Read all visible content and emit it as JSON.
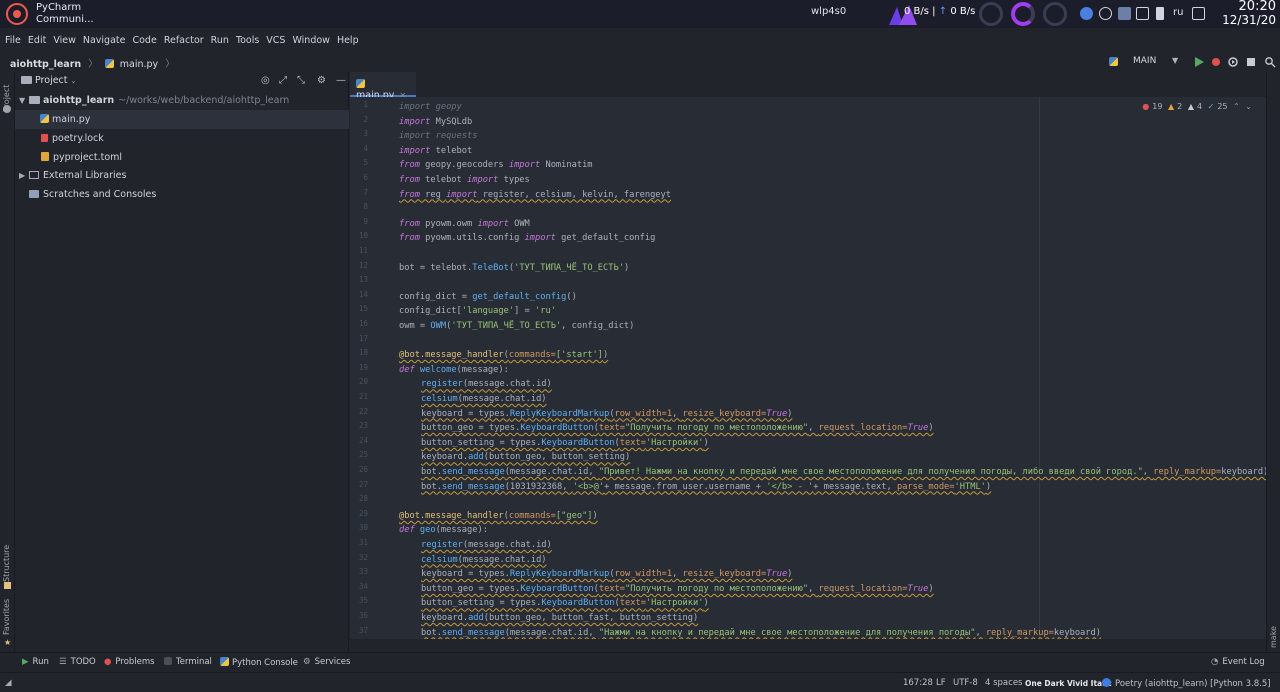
{
  "system_bar": {
    "app_name": "PyCharm",
    "app_sub": "Communi...",
    "network_name": "wlp4s0",
    "download": "0 B/s",
    "separator": "|",
    "upload_arrow": "↑",
    "upload": "0 B/s",
    "keyboard_layout": "ru",
    "time": "20:20",
    "date": "12/31/20"
  },
  "menu": [
    "File",
    "Edit",
    "View",
    "Navigate",
    "Code",
    "Refactor",
    "Run",
    "Tools",
    "VCS",
    "Window",
    "Help"
  ],
  "nav": {
    "project": "aiohttp_learn",
    "file": "main.py",
    "run_config": "MAIN"
  },
  "left_strip": {
    "project": "Project",
    "structure": "Structure",
    "favorites": "Favorites"
  },
  "right_strip": {
    "make": "make"
  },
  "project_panel": {
    "title": "Project",
    "root": {
      "name": "aiohttp_learn",
      "path": "~/works/web/backend/aiohttp_learn"
    },
    "files": [
      "main.py",
      "poetry.lock",
      "pyproject.toml"
    ],
    "external_libraries": "External Libraries",
    "scratches": "Scratches and Consoles"
  },
  "editor": {
    "tab": "main.py",
    "inspections": {
      "errors": "19",
      "warnings": "2",
      "weak": "4",
      "typos": "25"
    },
    "line_numbers": [
      "1",
      "2",
      "3",
      "4",
      "5",
      "6",
      "7",
      "8",
      "9",
      "10",
      "11",
      "12",
      "13",
      "14",
      "15",
      "16",
      "17",
      "18",
      "19",
      "20",
      "21",
      "22",
      "23",
      "24",
      "25",
      "26",
      "27",
      "28",
      "29",
      "30",
      "31",
      "32",
      "33",
      "34",
      "35",
      "36",
      "37"
    ]
  },
  "code": {
    "l1": {
      "a": "import",
      "b": " geopy"
    },
    "l2": {
      "a": "import",
      "b": " MySQLdb"
    },
    "l3": {
      "a": "import",
      "b": " requests"
    },
    "l4": {
      "a": "import",
      "b": " telebot"
    },
    "l5": {
      "a": "from",
      "b": " geopy.geocoders ",
      "c": "import",
      "d": " Nominatim"
    },
    "l6": {
      "a": "from",
      "b": " telebot ",
      "c": "import",
      "d": " types"
    },
    "l7": {
      "a": "from",
      "b": " reg ",
      "c": "import",
      "d": " register, celsium, kelvin, farengeyt"
    },
    "l9": {
      "a": "from",
      "b": " pyowm.owm ",
      "c": "import",
      "d": " OWM"
    },
    "l10": {
      "a": "from",
      "b": " pyowm.utils.config ",
      "c": "import",
      "d": " get_default_config"
    },
    "l12": {
      "a": "bot = telebot.",
      "b": "TeleBot",
      "c": "(",
      "d": "'ТУТ_ТИПА_ЧЁ_ТО_ЕСТЬ'",
      "e": ")"
    },
    "l14": {
      "a": "config_dict = ",
      "b": "get_default_config",
      "c": "()"
    },
    "l15": {
      "a": "config_dict[",
      "b": "'language'",
      "c": "] = ",
      "d": "'ru'"
    },
    "l16": {
      "a": "owm = ",
      "b": "OWM",
      "c": "(",
      "d": "'ТУТ_ТИПА_ЧЁ_ТО_ЕСТЬ'",
      "e": ", config_dict)"
    },
    "l18": {
      "a": "@bot.message_handler",
      "b": "(",
      "c": "commands=",
      "d": "['start']",
      "e": ")"
    },
    "l19": {
      "a": "def",
      "b": " welcome",
      "c": "(message):"
    },
    "l20": {
      "a": "register",
      "b": "(message.chat.id)"
    },
    "l21": {
      "a": "celsium",
      "b": "(message.chat.id)"
    },
    "l22": {
      "a": "keyboard = types.",
      "b": "ReplyKeyboardMarkup",
      "c": "(",
      "d": "row_width=",
      "e": "1",
      "f": ", ",
      "g": "resize_keyboard=",
      "h": "True",
      "i": ")"
    },
    "l23": {
      "a": "button_geo = types.",
      "b": "KeyboardButton",
      "c": "(",
      "d": "text=",
      "e": "\"Получить погоду по местоположению\"",
      "f": ", ",
      "g": "request_location=",
      "h": "True",
      "i": ")"
    },
    "l24": {
      "a": "button_setting = types.",
      "b": "KeyboardButton",
      "c": "(",
      "d": "text=",
      "e": "'Настройки'",
      "f": ")"
    },
    "l25": {
      "a": "keyboard.",
      "b": "add",
      "c": "(button_geo, button_setting)"
    },
    "l26": {
      "a": "bot.",
      "b": "send_message",
      "c": "(message.chat.id, ",
      "d": "\"Привет! Нажми на кнопку и передай мне свое местоположение для получения погоды, либо введи свой город.\"",
      "e": ", ",
      "f": "reply_markup=",
      "g": "keyboard)"
    },
    "l27": {
      "a": "bot.",
      "b": "send_message",
      "c": "(1031932368, ",
      "d": "'<b>@'",
      "e": "+ message.from_user.username + ",
      "f": "'</b> - '",
      "g": "+ message.text, ",
      "h": "parse_mode=",
      "i": "'HTML'",
      "j": ")"
    },
    "l29": {
      "a": "@bot.message_handler",
      "b": "(",
      "c": "commands=",
      "d": "[\"geo\"]",
      "e": ")"
    },
    "l30": {
      "a": "def",
      "b": " geo",
      "c": "(message):"
    },
    "l31": {
      "a": "register",
      "b": "(message.chat.id)"
    },
    "l32": {
      "a": "celsium",
      "b": "(message.chat.id)"
    },
    "l33": {
      "a": "keyboard = types.",
      "b": "ReplyKeyboardMarkup",
      "c": "(",
      "d": "row_width=",
      "e": "1",
      "f": ", ",
      "g": "resize_keyboard=",
      "h": "True",
      "i": ")"
    },
    "l34": {
      "a": "button_geo = types.",
      "b": "KeyboardButton",
      "c": "(",
      "d": "text=",
      "e": "\"Получить погоду по местоположению\"",
      "f": ", ",
      "g": "request_location=",
      "h": "True",
      "i": ")"
    },
    "l35": {
      "a": "button_setting = types.",
      "b": "KeyboardButton",
      "c": "(",
      "d": "text=",
      "e": "'Настройки'",
      "f": ")"
    },
    "l36": {
      "a": "keyboard.",
      "b": "add",
      "c": "(button_geo, button_fast, button_setting)"
    },
    "l37": {
      "a": "bot.",
      "b": "send_message",
      "c": "(message.chat.id, ",
      "d": "\"Нажми на кнопку и передай мне свое местоположение для получения погоды\"",
      "e": ", ",
      "f": "reply_markup=",
      "g": "keyboard)"
    }
  },
  "tool_windows": [
    "Run",
    "TODO",
    "Problems",
    "Terminal",
    "Python Console",
    "Services"
  ],
  "event_log": "Event Log",
  "status": {
    "position": "167:28",
    "line_sep": "LF",
    "encoding": "UTF-8",
    "indent": "4 spaces",
    "theme": "One Dark Vivid Italic",
    "interpreter": "Poetry (aiohttp_learn) [Python 3.8.5]"
  },
  "colors": {
    "background": "#282c34",
    "panel": "#21252b",
    "keyword": "#c678dd",
    "string": "#98c379",
    "function": "#61afef",
    "accent": "#4d78cc"
  }
}
